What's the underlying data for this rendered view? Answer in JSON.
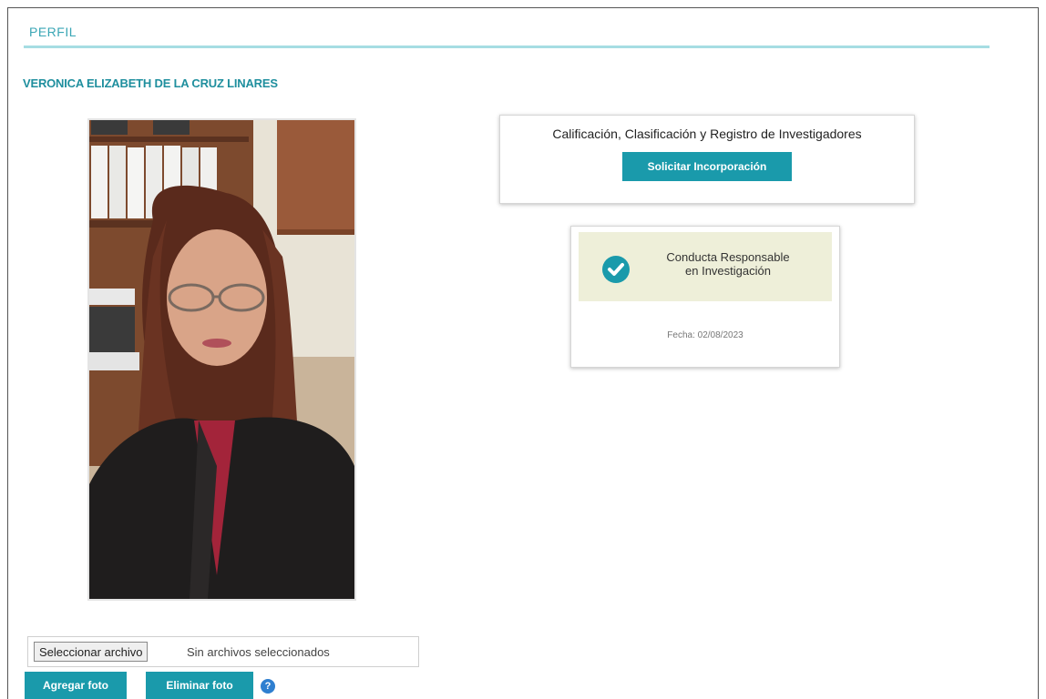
{
  "header": {
    "title": "PERFIL"
  },
  "profile": {
    "name": "VERONICA ELIZABETH DE LA CRUZ LINARES",
    "photo_icon": "profile-photo"
  },
  "ccri_card": {
    "title": "Calificación, Clasificación y Registro de Investigadores",
    "button_label": "Solicitar Incorporación"
  },
  "cri_card": {
    "badge_text_line1": "Conducta Responsable",
    "badge_text_line2": "en Investigación",
    "date_text": "Fecha: 02/08/2023",
    "icon": "check-circle-icon"
  },
  "upload": {
    "choose_button_label": "Seleccionar archivo",
    "file_status": "Sin archivos seleccionados",
    "add_photo_label": "Agregar foto",
    "delete_photo_label": "Eliminar foto",
    "help_glyph": "?"
  },
  "colors": {
    "accent": "#1a9aab",
    "title_text": "#3aa6b5",
    "rule": "#a6dde3",
    "badge_bg": "#eeefd9"
  }
}
